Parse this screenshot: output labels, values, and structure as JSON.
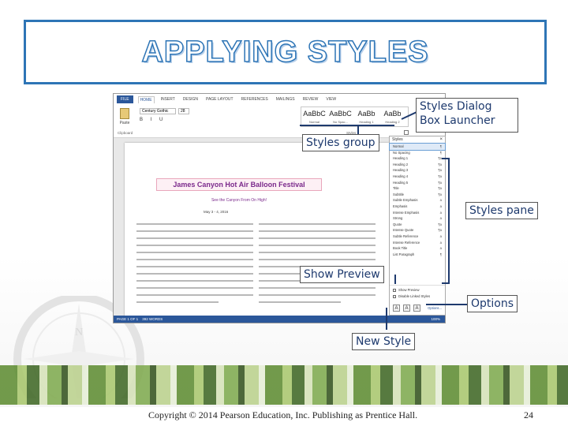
{
  "slide": {
    "title": "APPLYING STYLES",
    "copyright": "Copyright © 2014 Pearson Education, Inc. Publishing as Prentice Hall.",
    "page_number": "24"
  },
  "callouts": {
    "dialog_launcher": "Styles Dialog Box Launcher",
    "styles_group": "Styles group",
    "styles_pane": "Styles pane",
    "show_preview": "Show Preview",
    "options": "Options",
    "new_style": "New Style"
  },
  "word": {
    "tabs": [
      "FILE",
      "HOME",
      "INSERT",
      "DESIGN",
      "PAGE LAYOUT",
      "REFERENCES",
      "MAILINGS",
      "REVIEW",
      "VIEW"
    ],
    "font_name": "Century Gothic",
    "font_size": "28",
    "paste_label": "Paste",
    "group_labels": {
      "clipboard": "Clipboard",
      "styles": "Styles"
    },
    "style_gallery": [
      {
        "sample": "AaBbC",
        "name": "Normal"
      },
      {
        "sample": "AaBbC",
        "name": "No Spac..."
      },
      {
        "sample": "AaBb",
        "name": "Heading 1"
      },
      {
        "sample": "AaBb",
        "name": "Heading 2"
      }
    ],
    "document": {
      "title": "James Canyon Hot Air Balloon Festival",
      "subtitle": "See the Canyon From On High!",
      "date": "May 3 - 4, 2016"
    },
    "status": {
      "page": "PAGE 1 OF 1",
      "words": "392 WORDS",
      "zoom": "100%"
    }
  },
  "styles_pane": {
    "header": "Styles",
    "items": [
      {
        "name": "Normal",
        "mark": "¶",
        "selected": true
      },
      {
        "name": "No Spacing",
        "mark": "¶"
      },
      {
        "name": "Heading 1",
        "mark": "¶a"
      },
      {
        "name": "Heading 2",
        "mark": "¶a"
      },
      {
        "name": "Heading 3",
        "mark": "¶a"
      },
      {
        "name": "Heading 4",
        "mark": "¶a"
      },
      {
        "name": "Heading 5",
        "mark": "¶a"
      },
      {
        "name": "Title",
        "mark": "¶a"
      },
      {
        "name": "Subtitle",
        "mark": "¶a"
      },
      {
        "name": "Subtle Emphasis",
        "mark": "a"
      },
      {
        "name": "Emphasis",
        "mark": "a"
      },
      {
        "name": "Intense Emphasis",
        "mark": "a"
      },
      {
        "name": "Strong",
        "mark": "a"
      },
      {
        "name": "Quote",
        "mark": "¶a"
      },
      {
        "name": "Intense Quote",
        "mark": "¶a"
      },
      {
        "name": "Subtle Reference",
        "mark": "a"
      },
      {
        "name": "Intense Reference",
        "mark": "a"
      },
      {
        "name": "Book Title",
        "mark": "a"
      },
      {
        "name": "List Paragraph",
        "mark": "¶"
      }
    ],
    "show_preview_label": "Show Preview",
    "disable_linked_label": "Disable Linked Styles",
    "options_link": "Options..."
  },
  "colors": {
    "accent": "#2e75b6",
    "callout_text": "#1e3a6e",
    "word_blue": "#2b579a"
  }
}
